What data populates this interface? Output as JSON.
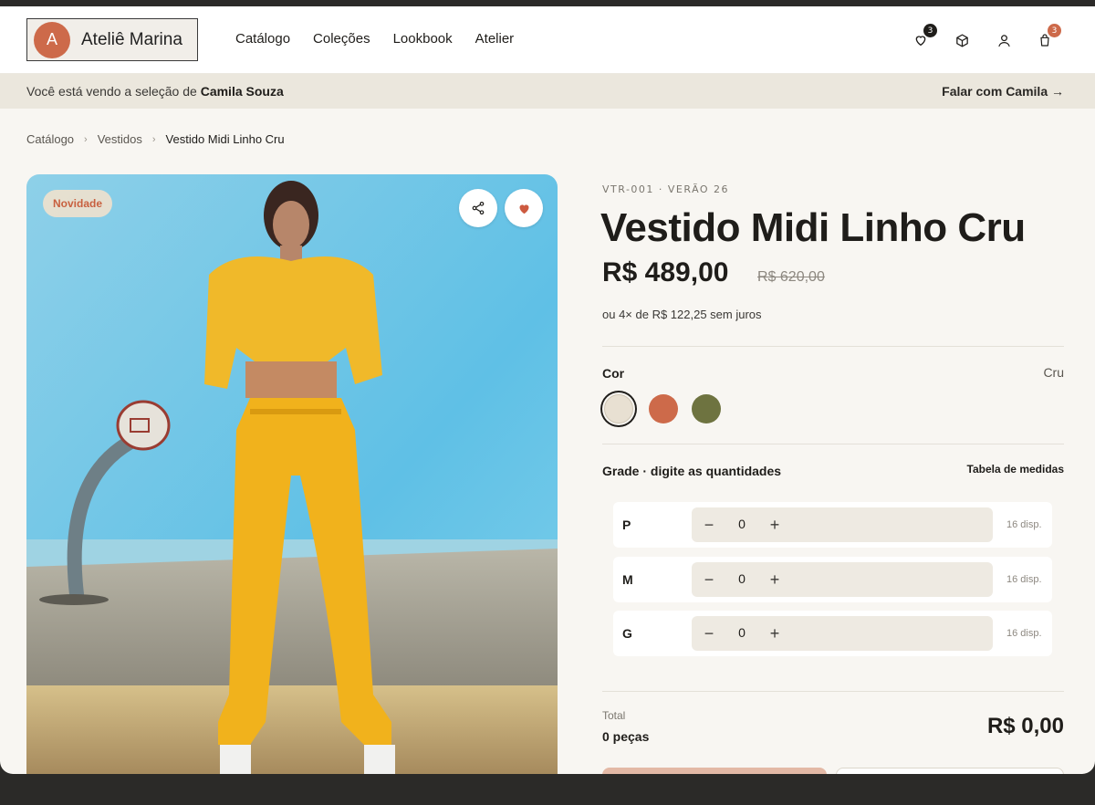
{
  "brand": {
    "initial": "A",
    "name": "Ateliê Marina"
  },
  "nav": [
    {
      "label": "Catálogo"
    },
    {
      "label": "Coleções"
    },
    {
      "label": "Lookbook"
    },
    {
      "label": "Atelier"
    }
  ],
  "header_icons": {
    "favorites": {
      "icon": "heart-icon",
      "badge": "3",
      "badge_color": "#1f1d1a"
    },
    "orders": {
      "icon": "box-icon"
    },
    "account": {
      "icon": "user-icon"
    },
    "bag": {
      "icon": "bag-icon",
      "badge": "3",
      "badge_color": "#cd6a4a"
    }
  },
  "notice": {
    "prefix": "Você está vendo a seleção de",
    "name": "Camila Souza",
    "action": "Falar com Camila →"
  },
  "breadcrumb": {
    "items": [
      "Catálogo",
      "Vestidos"
    ],
    "current": "Vestido Midi Linho Cru",
    "separator": "›"
  },
  "image": {
    "badge": "Novidade",
    "share_icon": "share-icon",
    "favorite_icon": "heart-filled-icon"
  },
  "product": {
    "sku": "VTR-001 · VERÃO 26",
    "title": "Vestido Midi Linho Cru",
    "price": "R$ 489,00",
    "old_price": "R$ 620,00",
    "installments": "ou 4× de R$ 122,25 sem juros"
  },
  "color": {
    "label": "Cor",
    "selected": "Cru",
    "swatches": [
      {
        "name": "Cru",
        "hex": "#e8e0d2"
      },
      {
        "name": "Terracota",
        "hex": "#cd6a4a"
      },
      {
        "name": "Oliva",
        "hex": "#6e7340"
      }
    ]
  },
  "grade": {
    "label": "Grade · digite as quantidades",
    "size_chart": "Tabela de medidas",
    "sizes": [
      {
        "size": "P",
        "qty": "0",
        "available": "16 disp."
      },
      {
        "size": "M",
        "qty": "0",
        "available": "16 disp."
      },
      {
        "size": "G",
        "qty": "0",
        "available": "16 disp."
      }
    ]
  },
  "total": {
    "label": "Total",
    "count": "0 peças",
    "value": "R$ 0,00"
  }
}
